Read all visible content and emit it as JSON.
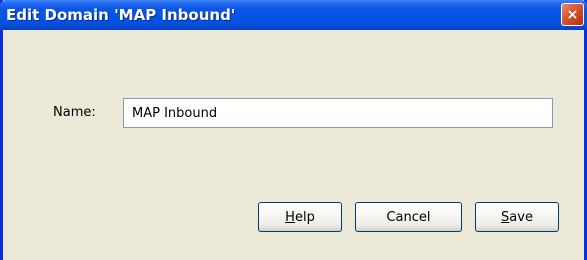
{
  "window": {
    "title": "Edit Domain 'MAP Inbound'",
    "close_icon": "close-icon"
  },
  "form": {
    "name_label": "Name:",
    "name_value": "MAP Inbound"
  },
  "buttons": {
    "help": {
      "mnemonic": "H",
      "rest": "elp"
    },
    "cancel": {
      "label": "Cancel"
    },
    "save": {
      "mnemonic": "S",
      "rest": "ave"
    }
  },
  "colors": {
    "titlebar": "#0555e5",
    "window_bg": "#ece9d8",
    "close_button": "#d9603f",
    "border": "#0831d9"
  }
}
